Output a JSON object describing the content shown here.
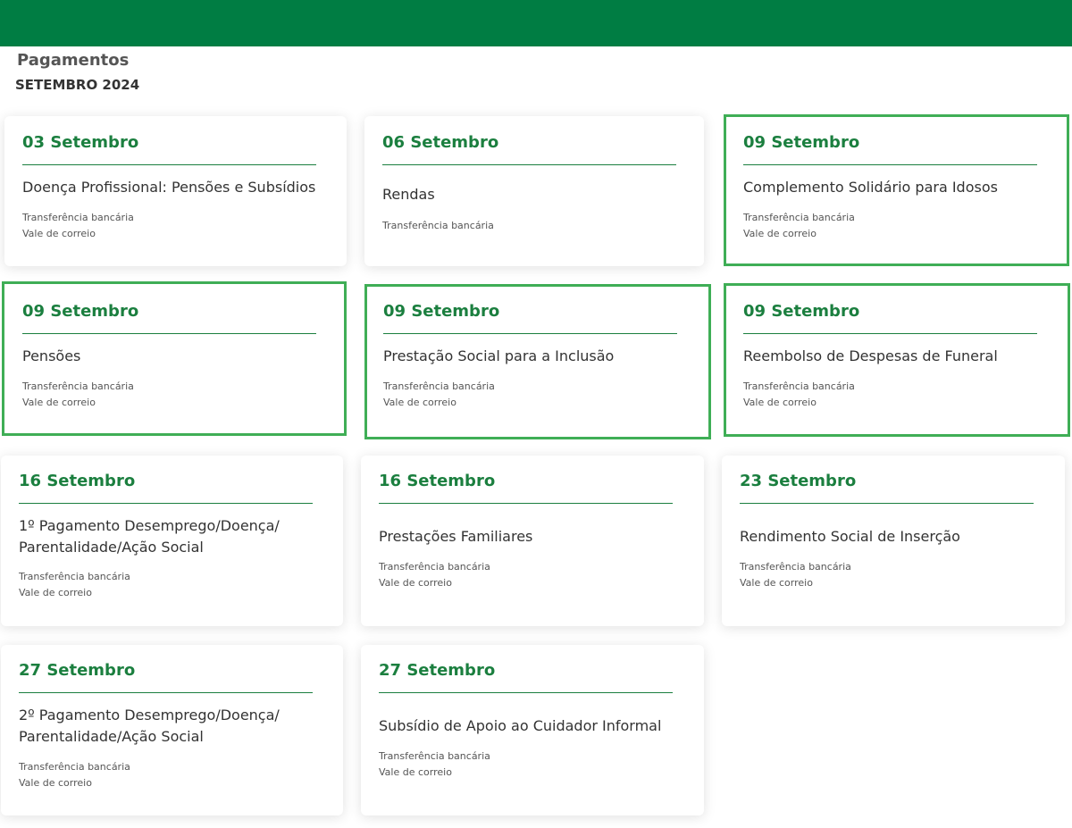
{
  "header": {
    "title": "Pagamentos",
    "subtitle": "SETEMBRO 2024"
  },
  "colors": {
    "brand_green": "#007d43",
    "date_green": "#1b7f3f",
    "highlight_green": "#3fae56"
  },
  "cards": [
    {
      "date": "03 Setembro",
      "title": "Doença Profissional: Pensões e Subsídios",
      "methods": [
        "Transferência bancária",
        "Vale de correio"
      ]
    },
    {
      "date": "06 Setembro",
      "title": "Rendas",
      "methods": [
        "Transferência bancária"
      ]
    },
    {
      "date": "09 Setembro",
      "title": "Complemento Solidário para Idosos",
      "methods": [
        "Transferência bancária",
        "Vale de correio"
      ]
    },
    {
      "date": "09 Setembro",
      "title": "Pensões",
      "methods": [
        "Transferência bancária",
        "Vale de correio"
      ]
    },
    {
      "date": "09 Setembro",
      "title": "Prestação Social para a Inclusão",
      "methods": [
        "Transferência bancária",
        "Vale de correio"
      ]
    },
    {
      "date": "09 Setembro",
      "title": "Reembolso de Despesas de Funeral",
      "methods": [
        "Transferência bancária",
        "Vale de correio"
      ]
    },
    {
      "date": "16 Setembro",
      "title": "1º Pagamento Desemprego/Doença/ Parentalidade/Ação Social",
      "methods": [
        "Transferência bancária",
        "Vale de correio"
      ]
    },
    {
      "date": "16 Setembro",
      "title": "Prestações Familiares",
      "methods": [
        "Transferência bancária",
        "Vale de correio"
      ]
    },
    {
      "date": "23 Setembro",
      "title": "Rendimento Social de Inserção",
      "methods": [
        "Transferência bancária",
        "Vale de correio"
      ]
    },
    {
      "date": "27 Setembro",
      "title": "2º Pagamento Desemprego/Doença/ Parentalidade/Ação Social",
      "methods": [
        "Transferência bancária",
        "Vale de correio"
      ]
    },
    {
      "date": "27 Setembro",
      "title": "Subsídio de Apoio ao Cuidador Informal",
      "methods": [
        "Transferência bancária",
        "Vale de correio"
      ]
    }
  ]
}
